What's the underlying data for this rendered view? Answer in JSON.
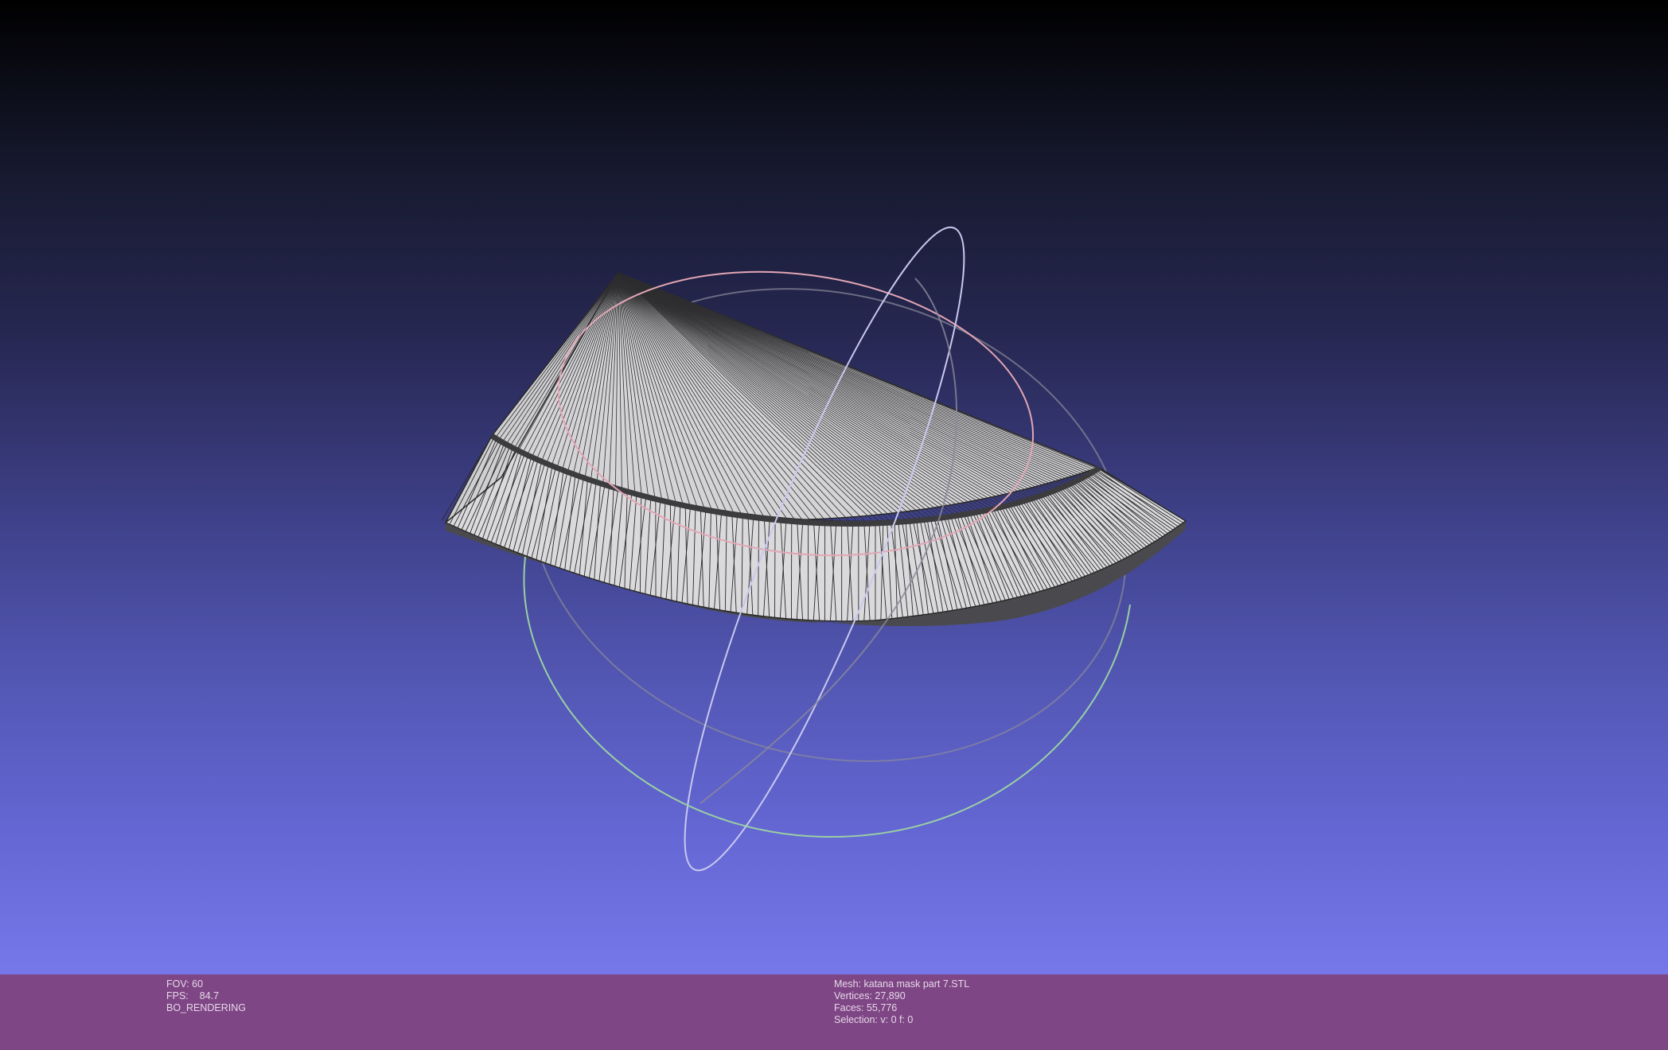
{
  "viewer": {
    "background_top": "#000000",
    "background_bottom": "#7678ea",
    "mesh_fill": "#d2d2d4",
    "mesh_edge": "#202020",
    "trackball_colors": {
      "x_ring": "#e2a6b4",
      "y_ring": "#c8c8f0",
      "z_ring": "#9ad0a4",
      "outline": "#8a8a9a"
    }
  },
  "info_left": {
    "fov_label": "FOV: 60",
    "fps_label": "FPS:",
    "fps_value": "84.7",
    "render_mode": "BO_RENDERING"
  },
  "info_right": {
    "mesh": "Mesh: katana mask part 7.STL",
    "vertices": "Vertices: 27,890",
    "faces": "Faces: 55,776",
    "selection": "Selection: v: 0 f: 0"
  }
}
